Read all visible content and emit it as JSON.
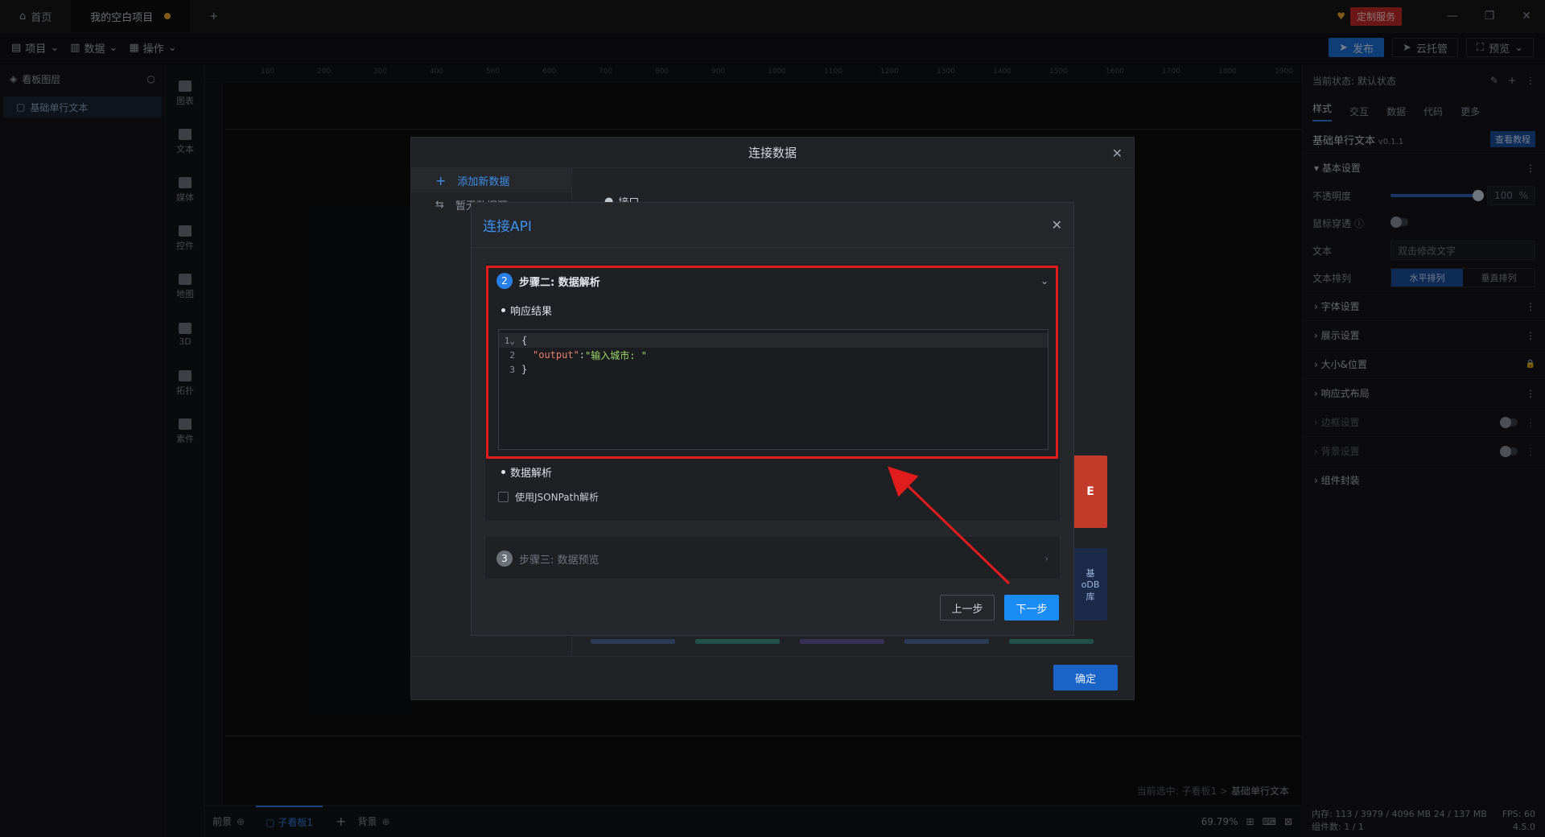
{
  "titlebar": {
    "tabs": [
      {
        "label": "首页",
        "icon": "home-icon"
      },
      {
        "label": "我的空白项目",
        "unsaved": true
      }
    ],
    "custom_service": "定制服务",
    "window_controls": [
      "—",
      "❐",
      "✕"
    ]
  },
  "toolbar": {
    "menus": [
      "项目",
      "数据",
      "操作"
    ],
    "publish": "发布",
    "cloud_host": "云托管",
    "preview": "预览"
  },
  "layers": {
    "title": "看板图层",
    "items": [
      "基础单行文本"
    ]
  },
  "components": [
    "图表",
    "文本",
    "媒体",
    "控件",
    "地图",
    "3D",
    "拓扑",
    "素件"
  ],
  "canvas": {
    "ruler_marks": [
      "100",
      "200",
      "300",
      "400",
      "500",
      "600",
      "700",
      "800",
      "900",
      "1000",
      "1100",
      "1200",
      "1300",
      "1400",
      "1500",
      "1600",
      "1700",
      "1800",
      "1900"
    ],
    "breadcrumb_prefix": "当前选中: 子看板1 >",
    "breadcrumb_item": "基础单行文本"
  },
  "bottombar": {
    "foreground": "前景",
    "sub_board": "子看板1",
    "background": "背景",
    "zoom": "69.79%"
  },
  "rightpanel": {
    "state_label": "当前状态:",
    "state_value": "默认状态",
    "tabs": [
      "样式",
      "交互",
      "数据",
      "代码",
      "更多"
    ],
    "component_name": "基础单行文本",
    "version": "v0.1.1",
    "tutorial": "查看教程",
    "basic_settings": "基本设置",
    "opacity_label": "不透明度",
    "opacity_value": "100",
    "opacity_unit": "%",
    "opacity_level": 1.0,
    "mouse_through": "鼠标穿透",
    "text_label": "文本",
    "text_placeholder": "双击修改文字",
    "text_arrange": "文本排列",
    "arrange_h": "水平排列",
    "arrange_v": "垂直排列",
    "sections": [
      {
        "label": "字体设置",
        "dim": false,
        "type": "more"
      },
      {
        "label": "展示设置",
        "dim": false,
        "type": "more"
      },
      {
        "label": "大小&位置",
        "dim": false,
        "type": "lock"
      },
      {
        "label": "响应式布局",
        "dim": false,
        "type": "more"
      },
      {
        "label": "边框设置",
        "dim": true,
        "type": "toggle"
      },
      {
        "label": "背景设置",
        "dim": true,
        "type": "toggle"
      },
      {
        "label": "组件封装",
        "dim": false,
        "type": "none"
      }
    ]
  },
  "perf": {
    "memory": "内存: 113 / 3979 / 4096 MB  24 / 137 MB",
    "fps": "FPS: 60",
    "count": "组件数: 1 / 1",
    "version": "4.5.0"
  },
  "outer_modal": {
    "title": "连接数据",
    "add_new": "添加新数据",
    "sidebar_second": "暂无数据源",
    "interface_label": "接口",
    "confirm": "确定",
    "tile_texts": [
      "E",
      "库",
      "基",
      "oDB",
      "库"
    ]
  },
  "inner_modal": {
    "title": "连接API",
    "step2": {
      "num": "2",
      "title": "步骤二: 数据解析"
    },
    "response_label": "响应结果",
    "code": {
      "lines": [
        {
          "n": "1",
          "fold": "⌄",
          "text": "{"
        },
        {
          "n": "2",
          "key": "\"output\"",
          "colon": ":",
          "value": "\"输入城市: \""
        },
        {
          "n": "3",
          "text": "}"
        }
      ]
    },
    "parse_label": "数据解析",
    "jsonpath_label": "使用JSONPath解析",
    "step3": {
      "num": "3",
      "title": "步骤三: 数据预览"
    },
    "prev": "上一步",
    "next": "下一步"
  },
  "colors": {
    "accent": "#1c8cf5",
    "highlight": "#e01c1c",
    "annotation_arrow": "#e01c1c"
  }
}
